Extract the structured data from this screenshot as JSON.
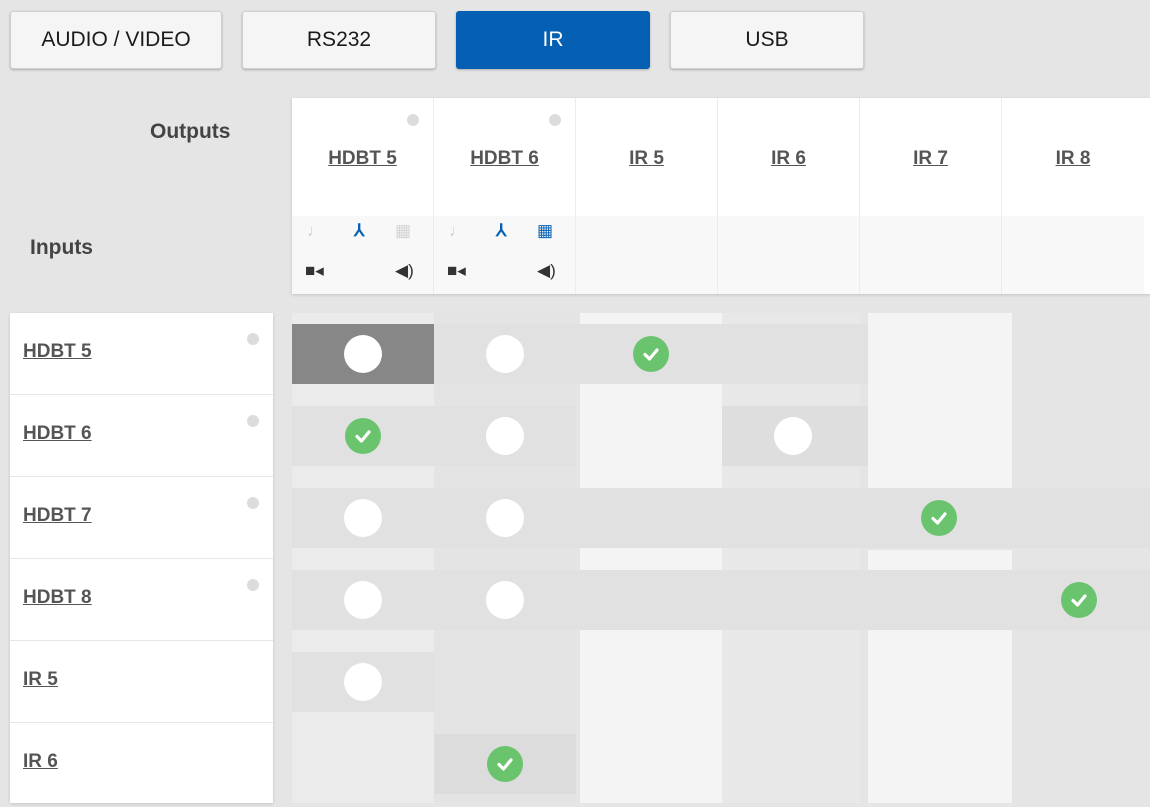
{
  "tabs": [
    {
      "label": "AUDIO / VIDEO",
      "active": false
    },
    {
      "label": "RS232",
      "active": false
    },
    {
      "label": "IR",
      "active": true
    },
    {
      "label": "USB",
      "active": false
    }
  ],
  "header": {
    "outputs_label": "Outputs",
    "inputs_label": "Inputs"
  },
  "outputs": [
    {
      "label": "HDBT 5"
    },
    {
      "label": "HDBT 6"
    },
    {
      "label": "IR 5"
    },
    {
      "label": "IR 6"
    },
    {
      "label": "IR 7"
    },
    {
      "label": "IR 8"
    }
  ],
  "inputs": [
    {
      "label": "HDBT 5"
    },
    {
      "label": "HDBT 6"
    },
    {
      "label": "HDBT 7"
    },
    {
      "label": "HDBT 8"
    },
    {
      "label": "IR 5"
    },
    {
      "label": "IR 6"
    }
  ],
  "matrix": [
    [
      "selected",
      "empty",
      "connected",
      "none",
      "none",
      "none"
    ],
    [
      "connected",
      "empty",
      "none",
      "empty",
      "none",
      "none"
    ],
    [
      "empty",
      "empty",
      "none",
      "none",
      "connected",
      "none"
    ],
    [
      "empty",
      "empty",
      "none",
      "none",
      "none",
      "connected"
    ],
    [
      "empty",
      "none",
      "none",
      "none",
      "none",
      "none"
    ],
    [
      "none",
      "connected",
      "none",
      "none",
      "none",
      "none"
    ]
  ],
  "colors": {
    "accent": "#0560b3",
    "connected": "#6ac46e"
  },
  "icons": [
    "music-note-icon",
    "merge-icon",
    "grid-icon",
    "video-camera-icon",
    "speaker-icon",
    "check-icon"
  ]
}
